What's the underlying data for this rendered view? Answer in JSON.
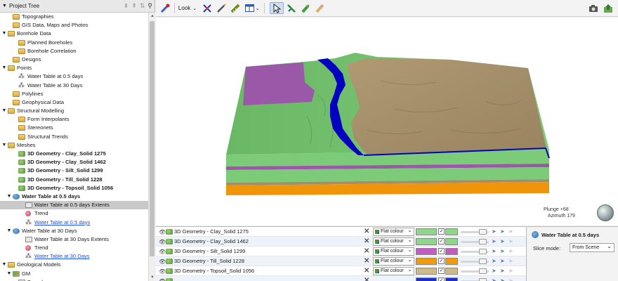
{
  "tree": {
    "title": "Project Tree",
    "items": [
      {
        "label": "Topographies",
        "level": 1,
        "icon": "folder",
        "arrow": ""
      },
      {
        "label": "GIS Data, Maps and Photos",
        "level": 1,
        "icon": "folder",
        "arrow": ""
      },
      {
        "label": "Borehole Data",
        "level": 0,
        "icon": "folder",
        "arrow": "▼"
      },
      {
        "label": "Planned Boreholes",
        "level": 2,
        "icon": "folder",
        "arrow": ""
      },
      {
        "label": "Borehole Correlation",
        "level": 2,
        "icon": "folder",
        "arrow": ""
      },
      {
        "label": "Designs",
        "level": 1,
        "icon": "folder",
        "arrow": ""
      },
      {
        "label": "Points",
        "level": 0,
        "icon": "folder",
        "arrow": "▼"
      },
      {
        "label": "Water Table at 0.5 days",
        "level": 2,
        "icon": "points",
        "arrow": ""
      },
      {
        "label": "Water Table at 30 Days",
        "level": 2,
        "icon": "points",
        "arrow": ""
      },
      {
        "label": "Polylines",
        "level": 1,
        "icon": "folder",
        "arrow": ""
      },
      {
        "label": "Geophysical Data",
        "level": 1,
        "icon": "folder",
        "arrow": ""
      },
      {
        "label": "Structural Modelling",
        "level": 0,
        "icon": "folder",
        "arrow": "▼"
      },
      {
        "label": "Form Interpolants",
        "level": 2,
        "icon": "folder",
        "arrow": ""
      },
      {
        "label": "Stereonets",
        "level": 2,
        "icon": "folder",
        "arrow": ""
      },
      {
        "label": "Structural Trends",
        "level": 2,
        "icon": "folder",
        "arrow": ""
      },
      {
        "label": "Meshes",
        "level": 0,
        "icon": "folder",
        "arrow": "▼"
      },
      {
        "label": "3D Geometry - Clay_Solid 1275",
        "level": 2,
        "icon": "mesh",
        "arrow": "",
        "bold": true
      },
      {
        "label": "3D Geometry - Clay_Solid 1462",
        "level": 2,
        "icon": "mesh",
        "arrow": "",
        "bold": true
      },
      {
        "label": "3D Geometry - Silt_Solid 1299",
        "level": 2,
        "icon": "mesh",
        "arrow": "",
        "bold": true
      },
      {
        "label": "3D Geometry - Till_Solid 1228",
        "level": 2,
        "icon": "mesh",
        "arrow": "",
        "bold": true
      },
      {
        "label": "3D Geometry - Topsoil_Solid 1056",
        "level": 2,
        "icon": "mesh",
        "arrow": "",
        "bold": true
      },
      {
        "label": "Water Table at 0.5 days",
        "level": 1,
        "icon": "water",
        "arrow": "▼",
        "bold": true
      },
      {
        "label": "Water Table at 0.5 days Extents",
        "level": 3,
        "icon": "extent",
        "arrow": "",
        "selected": true
      },
      {
        "label": "Trend",
        "level": 3,
        "icon": "trend",
        "arrow": ""
      },
      {
        "label": "Water Table at 0.5 days",
        "level": 3,
        "icon": "points",
        "arrow": "",
        "link": true
      },
      {
        "label": "Water Table at 30 Days",
        "level": 1,
        "icon": "water",
        "arrow": "▼"
      },
      {
        "label": "Water Table at 30 Days Extents",
        "level": 3,
        "icon": "extent",
        "arrow": ""
      },
      {
        "label": "Trend",
        "level": 3,
        "icon": "trend",
        "arrow": ""
      },
      {
        "label": "Water Table at 30 Days",
        "level": 3,
        "icon": "points",
        "arrow": "",
        "link": true
      },
      {
        "label": "Geological Models",
        "level": 0,
        "icon": "folder",
        "arrow": "▼"
      },
      {
        "label": "GM",
        "level": 1,
        "icon": "gm",
        "arrow": "▼"
      },
      {
        "label": "Boundary",
        "level": 2,
        "icon": "extent",
        "arrow": ""
      }
    ]
  },
  "toolbar": {
    "look_label": "Look"
  },
  "viewport": {
    "plunge": "Plunge +68",
    "azimuth": "Azimuth 179",
    "colors": {
      "topsoil": "#a38e6a",
      "silt": "#9c58a8",
      "till": "#f0950a",
      "clay": "#7ccb78",
      "water": "#0202c0"
    }
  },
  "shapes": [
    {
      "name": "3D Geometry - Clay_Solid 1275",
      "mode": "Flat colour",
      "color": "#8fd58a"
    },
    {
      "name": "3D Geometry - Clay_Solid 1462",
      "mode": "Flat colour",
      "color": "#8fd58a"
    },
    {
      "name": "3D Geometry - Silt_Solid 1299",
      "mode": "Flat colour",
      "color": "#c05cc4"
    },
    {
      "name": "3D Geometry - Till_Solid 1228",
      "mode": "Flat colour",
      "color": "#f09a08"
    },
    {
      "name": "3D Geometry - Topsoil_Solid 1056",
      "mode": "Flat colour",
      "color": "#cdb98a"
    },
    {
      "name": "",
      "mode": "",
      "color": "#1c2fc8"
    }
  ],
  "props": {
    "title": "Water Table at 0.5 days",
    "slice_label": "Slice mode:",
    "slice_value": "From Scene"
  }
}
